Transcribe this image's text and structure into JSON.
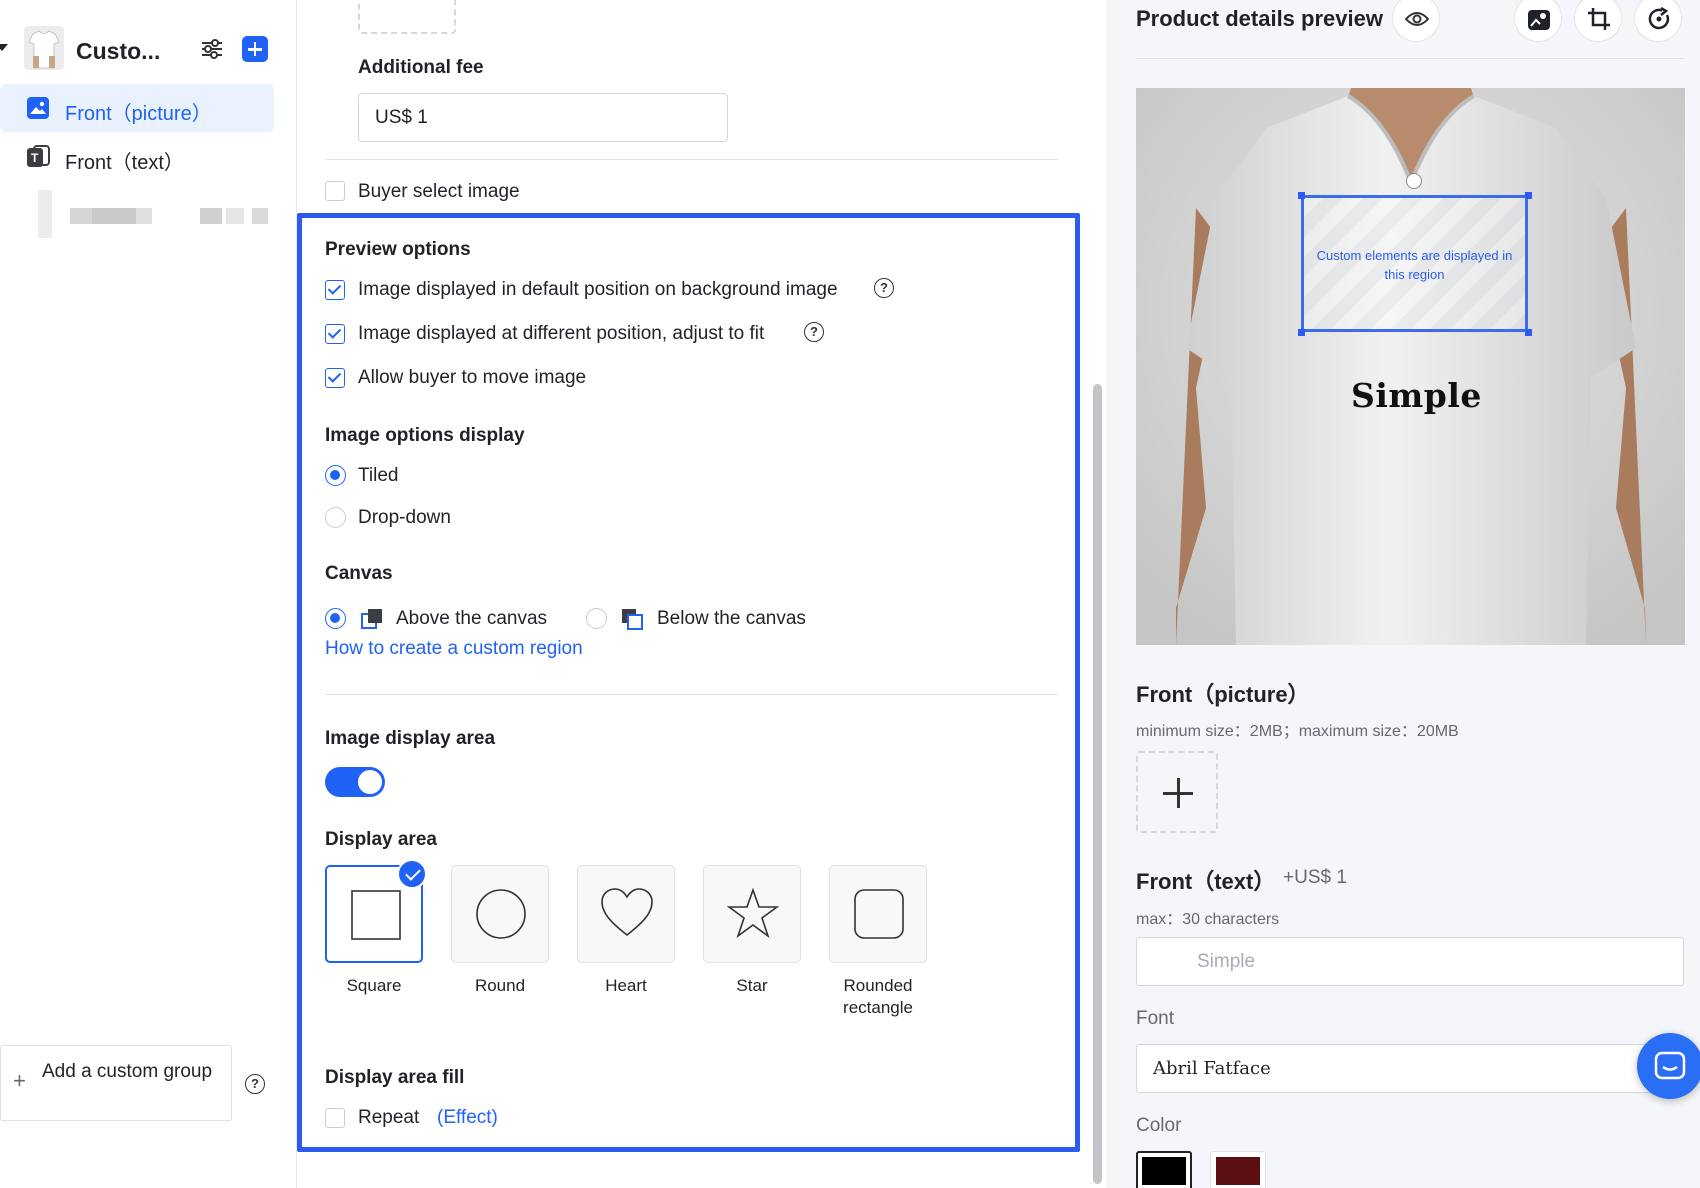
{
  "sidebar": {
    "group_name": "Custo...",
    "items": [
      {
        "label": "Front（picture）",
        "active": true
      },
      {
        "label": "Front（text）",
        "active": false
      }
    ],
    "add_group_label": "Add a custom group"
  },
  "form": {
    "additional_fee_label": "Additional fee",
    "additional_fee_value": "US$ 1",
    "buyer_select_image_label": "Buyer select image",
    "buyer_select_image_checked": false,
    "preview_options": {
      "title": "Preview options",
      "options": [
        {
          "label": "Image displayed in default position on background image",
          "checked": true,
          "help": true
        },
        {
          "label": "Image displayed at different position, adjust to fit",
          "checked": true,
          "help": true
        },
        {
          "label": "Allow buyer to move image",
          "checked": true,
          "help": false
        }
      ]
    },
    "image_options_display": {
      "title": "Image options display",
      "options": [
        {
          "label": "Tiled",
          "selected": true
        },
        {
          "label": "Drop-down",
          "selected": false
        }
      ]
    },
    "canvas": {
      "title": "Canvas",
      "above_label": "Above the canvas",
      "below_label": "Below the canvas",
      "selected": "above",
      "help_link": "How to create a custom region"
    },
    "image_display_area": {
      "title": "Image display area",
      "enabled": true
    },
    "display_area": {
      "title": "Display area",
      "shapes": [
        {
          "label": "Square",
          "selected": true
        },
        {
          "label": "Round",
          "selected": false
        },
        {
          "label": "Heart",
          "selected": false
        },
        {
          "label": "Star",
          "selected": false
        },
        {
          "label": "Rounded rectangle",
          "selected": false
        }
      ]
    },
    "display_area_fill": {
      "title": "Display area fill",
      "repeat_label": "Repeat",
      "repeat_checked": false,
      "effect_link": "(Effect)"
    }
  },
  "preview": {
    "title": "Product details preview",
    "custom_region_text": "Custom elements are displayed in this region",
    "shirt_text": "Simple",
    "picture_section": {
      "title": "Front（picture）",
      "size_hint": "minimum size：2MB；maximum size：20MB"
    },
    "text_section": {
      "title": "Front（text）",
      "fee": "+US$ 1",
      "max_hint": "max：30 characters",
      "placeholder": "Simple"
    },
    "font_label": "Font",
    "font_value": "Abril Fatface",
    "color_label": "Color",
    "colors": [
      "#000000",
      "#5c0f12"
    ]
  },
  "colors": {
    "accent": "#2062f5",
    "highlight_border": "#2b5bf0"
  }
}
